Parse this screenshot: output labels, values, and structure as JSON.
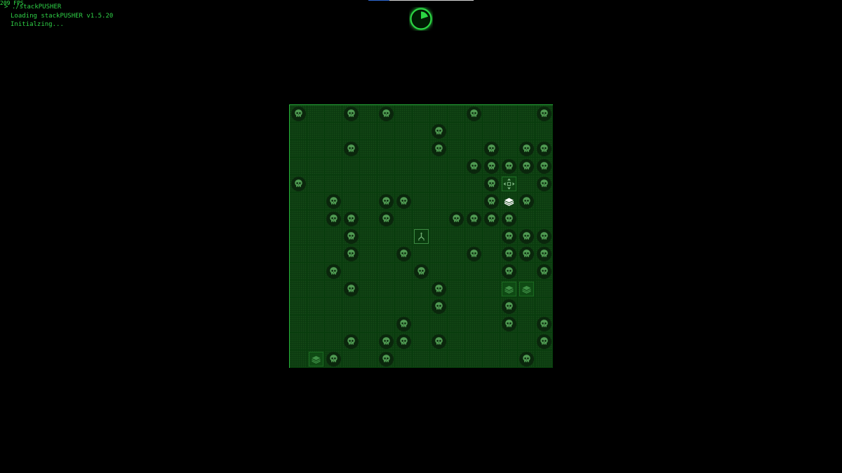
{
  "fps_counter": "209 FPS",
  "console": {
    "lines": [
      "> ./stackPUSHER",
      "Loading stackPUSHER v1.5.20",
      "Initialzing..."
    ]
  },
  "loading_bar": {
    "progress": 0.2
  },
  "loading_spinner": {
    "progress": 0.2
  },
  "colors": {
    "background": "#000000",
    "console_text": "#2fd247",
    "board_border": "#27b43a",
    "cell": "#0c3b10",
    "grid_line": "#073d0c",
    "skull": "#4f9a52",
    "skull_token": "#0a260c",
    "player": "#ffffff"
  },
  "board": {
    "rows": 15,
    "cols": 15,
    "skulls": [
      [
        0,
        0
      ],
      [
        0,
        3
      ],
      [
        0,
        5
      ],
      [
        0,
        10
      ],
      [
        0,
        14
      ],
      [
        1,
        8
      ],
      [
        2,
        3
      ],
      [
        2,
        8
      ],
      [
        2,
        11
      ],
      [
        2,
        13
      ],
      [
        2,
        14
      ],
      [
        3,
        10
      ],
      [
        3,
        11
      ],
      [
        3,
        12
      ],
      [
        3,
        13
      ],
      [
        3,
        14
      ],
      [
        4,
        0
      ],
      [
        4,
        11
      ],
      [
        4,
        14
      ],
      [
        5,
        2
      ],
      [
        5,
        5
      ],
      [
        5,
        6
      ],
      [
        5,
        11
      ],
      [
        5,
        13
      ],
      [
        6,
        2
      ],
      [
        6,
        3
      ],
      [
        6,
        5
      ],
      [
        6,
        9
      ],
      [
        6,
        10
      ],
      [
        6,
        11
      ],
      [
        6,
        12
      ],
      [
        7,
        3
      ],
      [
        7,
        12
      ],
      [
        7,
        13
      ],
      [
        7,
        14
      ],
      [
        8,
        3
      ],
      [
        8,
        6
      ],
      [
        8,
        10
      ],
      [
        8,
        12
      ],
      [
        8,
        13
      ],
      [
        8,
        14
      ],
      [
        9,
        2
      ],
      [
        9,
        7
      ],
      [
        9,
        12
      ],
      [
        9,
        14
      ],
      [
        10,
        3
      ],
      [
        10,
        8
      ],
      [
        11,
        8
      ],
      [
        11,
        12
      ],
      [
        12,
        6
      ],
      [
        12,
        12
      ],
      [
        12,
        14
      ],
      [
        13,
        3
      ],
      [
        13,
        5
      ],
      [
        13,
        6
      ],
      [
        13,
        8
      ],
      [
        13,
        14
      ],
      [
        14,
        2
      ],
      [
        14,
        5
      ],
      [
        14,
        13
      ]
    ],
    "player": {
      "row": 5,
      "col": 12,
      "icon": "stack-layers-icon"
    },
    "stack_goals": [
      [
        10,
        12
      ],
      [
        10,
        13
      ],
      [
        14,
        1
      ]
    ],
    "move_target": {
      "row": 4,
      "col": 12,
      "icon": "move-arrows-icon"
    },
    "spawn_marker": {
      "row": 7,
      "col": 7,
      "icon": "split-arrows-icon"
    }
  }
}
